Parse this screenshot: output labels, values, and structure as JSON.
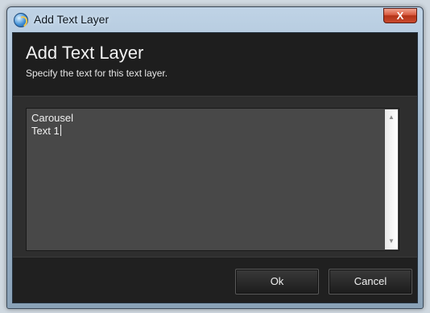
{
  "window": {
    "title": "Add Text Layer",
    "close_glyph": "X"
  },
  "header": {
    "title": "Add Text Layer",
    "subtitle": "Specify the text for this text layer."
  },
  "text_input": {
    "value": "Carousel\nText 1"
  },
  "scrollbar": {
    "up_glyph": "▲",
    "down_glyph": "▼"
  },
  "buttons": {
    "ok_label": "Ok",
    "cancel_label": "Cancel"
  },
  "icons": {
    "app": "app-icon",
    "close": "close-icon"
  }
}
